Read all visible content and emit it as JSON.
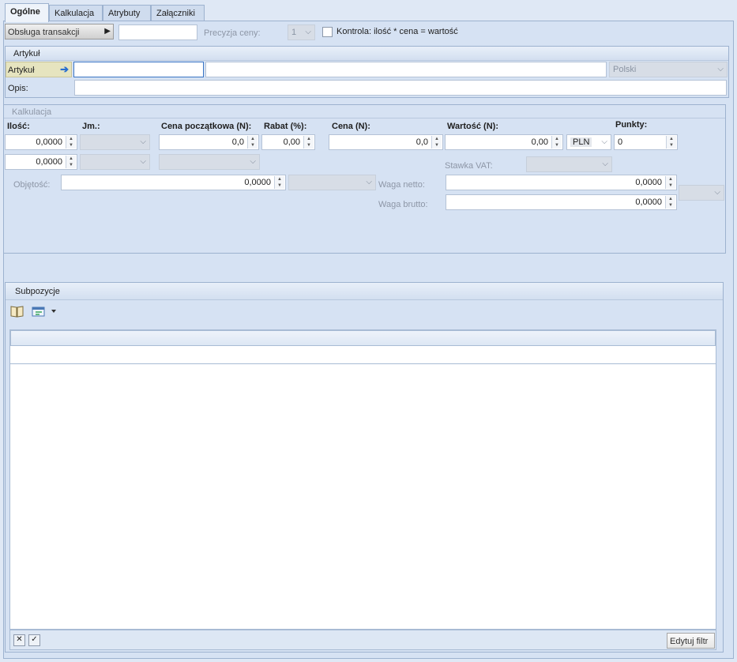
{
  "tabs": [
    "Ogólne",
    "Kalkulacja",
    "Atrybuty",
    "Załączniki"
  ],
  "top": {
    "transaction_button": "Obsługa transakcji",
    "transaction_value": "",
    "price_precision_label": "Precyzja ceny:",
    "price_precision_value": "1",
    "control_label": "Kontrola: ilość * cena = wartość"
  },
  "article_group": {
    "title": "Artykuł",
    "article_label": "Artykuł",
    "article_code": "",
    "article_name": "",
    "language": "Polski",
    "description_label": "Opis:",
    "description_value": ""
  },
  "calc_group": {
    "title": "Kalkulacja",
    "qty_label": "Ilość:",
    "unit_label": "Jm.:",
    "start_price_label": "Cena początkowa (N):",
    "discount_label": "Rabat (%):",
    "price_label": "Cena (N):",
    "value_label": "Wartość (N):",
    "points_label": "Punkty:",
    "qty1": "0,0000",
    "qty2": "0,0000",
    "start_price": "0,0",
    "discount": "0,00",
    "price": "0,0",
    "value": "0,00",
    "currency": "PLN",
    "points": "0",
    "vat_label": "Stawka VAT:",
    "volume_label": "Objętość:",
    "volume": "0,0000",
    "net_weight_label": "Waga netto:",
    "net_weight": "0,0000",
    "gross_weight_label": "Waga brutto:",
    "gross_weight": "0,0000"
  },
  "subitems": {
    "title": "Subpozycje",
    "edit_filter": "Edytuj filtr"
  }
}
